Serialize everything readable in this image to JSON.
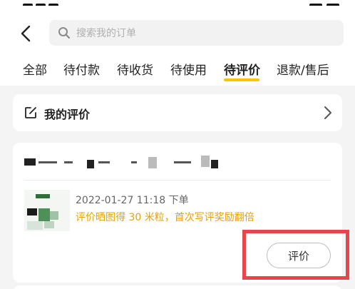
{
  "header": {
    "search_placeholder": "搜索我的订单"
  },
  "tabs": [
    {
      "label": "全部",
      "active": false
    },
    {
      "label": "待付款",
      "active": false
    },
    {
      "label": "待收货",
      "active": false
    },
    {
      "label": "待使用",
      "active": false
    },
    {
      "label": "待评价",
      "active": true
    },
    {
      "label": "退款/售后",
      "active": false
    }
  ],
  "my_reviews": {
    "label": "我的评价"
  },
  "order": {
    "time": "2022-01-27 11:18 下单",
    "promo": "评价晒图得 30 米粒，首次写评奖励翻倍",
    "review_button": "评价"
  },
  "colors": {
    "accent": "#ffc300",
    "promo": "#e8a100",
    "highlight": "#e6464a"
  },
  "icons": [
    "back-arrow-icon",
    "search-icon",
    "edit-icon",
    "chevron-right-icon"
  ]
}
